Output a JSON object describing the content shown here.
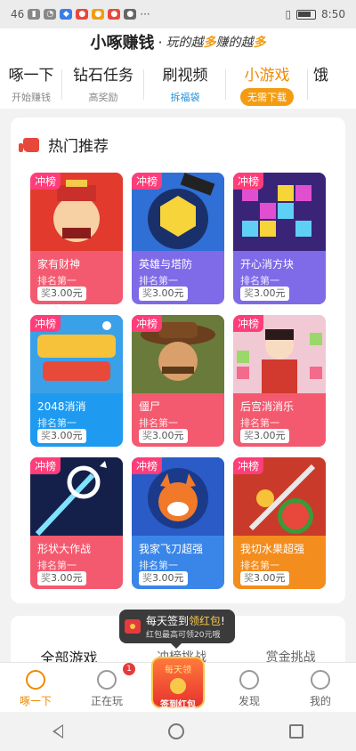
{
  "status": {
    "time": "8:50",
    "network": "46",
    "signal_icon": "signal-icon",
    "wifi_icon": "wifi-icon",
    "battery_icon": "battery-icon"
  },
  "header": {
    "brand": "小啄赚钱",
    "slogan_pre": "玩的越",
    "slogan_hl1": "多",
    "slogan_mid": "赚的越",
    "slogan_hl2": "多"
  },
  "tabs": [
    {
      "title": "啄一下",
      "sub": "开始赚钱"
    },
    {
      "title": "钻石任务",
      "sub": "高奖励"
    },
    {
      "title": "刷视频",
      "sub": "拆福袋"
    },
    {
      "title": "小游戏",
      "sub": "无需下载"
    },
    {
      "title": "饿"
    }
  ],
  "hot": {
    "title": "热门推荐",
    "badge": "冲榜",
    "rank_text": "排名第一",
    "reward_prefix": "奖",
    "reward_value": "3.00元",
    "games": [
      {
        "name": "家有财神",
        "color": "#f45a6f"
      },
      {
        "name": "英雄与塔防",
        "color": "#7f6ae8"
      },
      {
        "name": "开心消方块",
        "color": "#7f6ae8"
      },
      {
        "name": "2048消消",
        "color": "#1e9af0"
      },
      {
        "name": "僵尸",
        "color": "#f45a6f"
      },
      {
        "name": "后宫消消乐",
        "color": "#f45a6f"
      },
      {
        "name": "形状大作战",
        "color": "#f45a6f"
      },
      {
        "name": "我家飞刀超强",
        "color": "#3a86e8"
      },
      {
        "name": "我切水果超强",
        "color": "#f38d1e"
      }
    ]
  },
  "all": {
    "title": "全部游戏",
    "tab2": "冲榜挑战",
    "tab3": "赏金挑战"
  },
  "tooltip": {
    "line1_pre": "每天签到",
    "line1_hl": "领红包",
    "line1_post": "!",
    "line2": "红包最高可领20元哦"
  },
  "nav": {
    "items": [
      {
        "label": "啄一下"
      },
      {
        "label": "正在玩",
        "badge": "1"
      },
      {
        "label": ""
      },
      {
        "label": "发现"
      },
      {
        "label": "我的"
      }
    ],
    "checkin_top": "每天领",
    "checkin_bottom": "签到红包"
  }
}
